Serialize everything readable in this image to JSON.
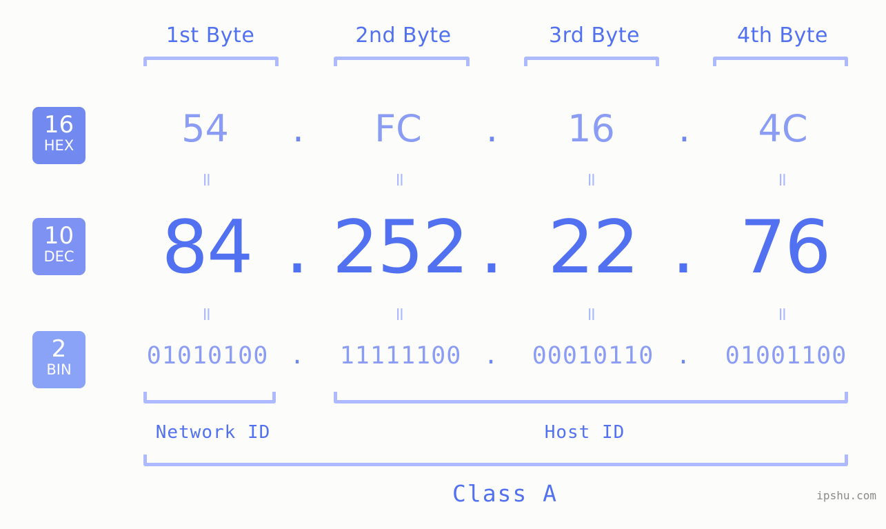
{
  "background_color": "#fcfdfa",
  "accent_strong": "#5271f0",
  "accent_light": "#8b9cf5",
  "bracket_color": "#aebaff",
  "byte_headers": [
    {
      "label": "1st Byte"
    },
    {
      "label": "2nd Byte"
    },
    {
      "label": "3rd Byte"
    },
    {
      "label": "4th Byte"
    }
  ],
  "rows": {
    "hex": {
      "base": "16",
      "system": "HEX",
      "badge_color": "#7289f0",
      "values": [
        "54",
        "FC",
        "16",
        "4C"
      ],
      "separator": "."
    },
    "dec": {
      "base": "10",
      "system": "DEC",
      "badge_color": "#7d92f2",
      "values": [
        "84",
        "252",
        "22",
        "76"
      ],
      "separator": "."
    },
    "bin": {
      "base": "2",
      "system": "BIN",
      "badge_color": "#8ba3f7",
      "values": [
        "01010100",
        "11111100",
        "00010110",
        "01001100"
      ],
      "separator": "."
    }
  },
  "equals_glyph": "=",
  "sections": {
    "network_id": "Network ID",
    "host_id": "Host ID",
    "class": "Class A"
  },
  "watermark": "ipshu.com"
}
